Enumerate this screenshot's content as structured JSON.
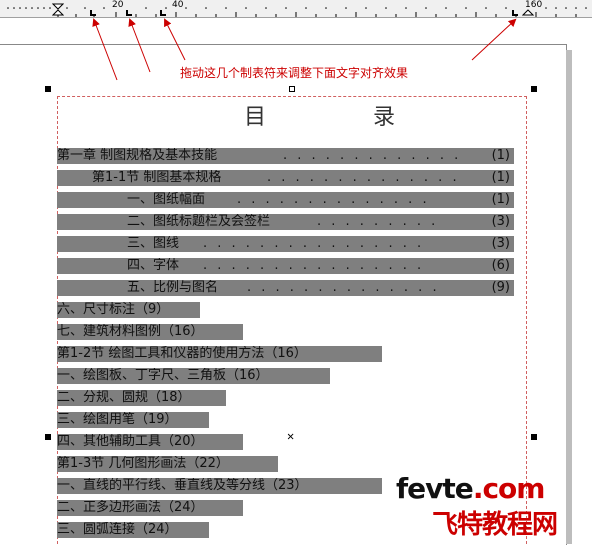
{
  "ruler": {
    "labels": [
      "20",
      "40",
      "160"
    ]
  },
  "callout": {
    "text": "拖动这几个制表符来调整下面文字对齐效果"
  },
  "document": {
    "title": "目 录",
    "lines": [
      {
        "text": "第一章  制图规格及基本技能",
        "dots": ". . . . . . . . . . . . .",
        "page": "(1)"
      },
      {
        "text": "第1-1节  制图基本规格",
        "dots": ". . . . . . . . . . . . . .",
        "page": "(1)"
      },
      {
        "text": "一、图纸幅面",
        "dots": ". . . . . . . . . . . . . .",
        "page": "(1)"
      },
      {
        "text": "二、图纸标题栏及会签栏",
        "dots": ". . . . . . . . .",
        "page": "(3)"
      },
      {
        "text": "三、图线",
        "dots": ". . . . . . . . . . . . . . . .",
        "page": "(3)"
      },
      {
        "text": "四、字体",
        "dots": ". . . . . . . . . . . . . . . .",
        "page": "(6)"
      },
      {
        "text": "五、比例与图名",
        "dots": ". . . . . . . . . . . . . .",
        "page": "(9)"
      },
      {
        "text": "六、尺寸标注（9）"
      },
      {
        "text": "七、建筑材料图例（16）"
      },
      {
        "text": "第1-2节  绘图工具和仪器的使用方法（16）"
      },
      {
        "text": "一、绘图板、丁字尺、三角板（16）"
      },
      {
        "text": "二、分规、圆规（18）"
      },
      {
        "text": "三、绘图用笔（19）"
      },
      {
        "text": "四、其他辅助工具（20）"
      },
      {
        "text": "第1-3节  几何图形画法（22）"
      },
      {
        "text": "一、直线的平行线、垂直线及等分线（23）"
      },
      {
        "text": "二、正多边形画法（24）"
      },
      {
        "text": "三、圆弧连接（24）"
      }
    ]
  },
  "watermark": {
    "line1_a": "fevte",
    "line1_b": ".com",
    "line2": "飞特教程网"
  },
  "colors": {
    "highlight": "#7f7f7f",
    "callout": "#cc0000",
    "frame": "#d06060"
  }
}
